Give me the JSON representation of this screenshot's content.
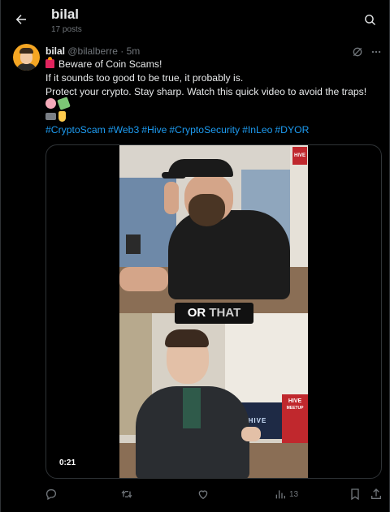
{
  "header": {
    "title": "bilal",
    "subtitle": "17 posts"
  },
  "post": {
    "author_name": "bilal",
    "author_handle": "@bilalberre",
    "separator": "·",
    "time": "5m",
    "lines": [
      "Beware of Coin Scams!",
      "If it sounds too good to be true, it probably is.",
      "Protect your crypto. Stay sharp. Watch this quick video to avoid the traps!"
    ],
    "hashtags": [
      "#CryptoScam",
      "#Web3",
      "#Hive",
      "#CryptoSecurity",
      "#InLeo",
      "#DYOR"
    ],
    "emoji_rows": [
      [
        "brain-emoji",
        "money-with-wings-emoji"
      ],
      [
        "movie-camera-emoji",
        "thumbs-down-emoji"
      ]
    ]
  },
  "video": {
    "caption_part1": "OR",
    "caption_part2": "THAT",
    "duration": "0:21",
    "sign_text": "HIVE",
    "banner_text": "HIVE",
    "banner_subtext": "MEETUP",
    "shirt_text": "HIVE"
  },
  "actions": {
    "reply_count": "",
    "repost_count": "",
    "like_count": "",
    "views_count": "13"
  },
  "colors": {
    "background": "#000000",
    "text": "#e7e9ea",
    "muted": "#71767b",
    "link": "#1d9bf0",
    "border": "#2f3336"
  }
}
